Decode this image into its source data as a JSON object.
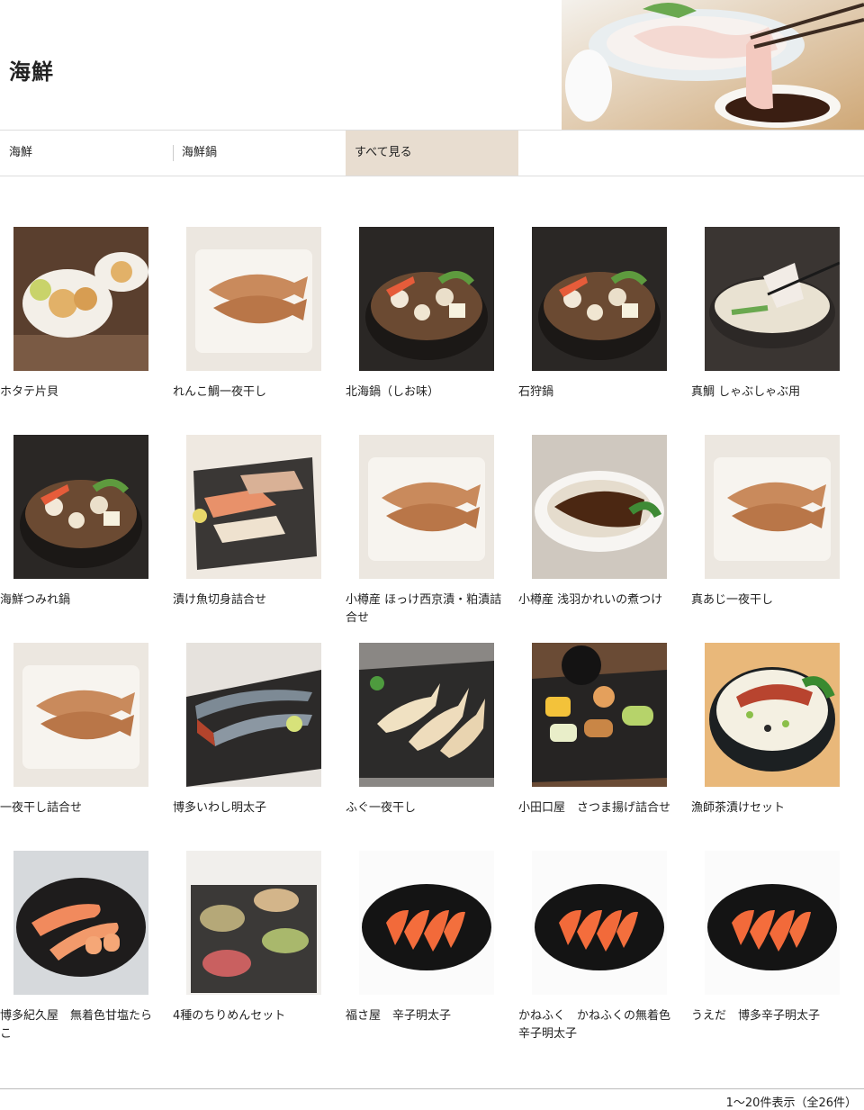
{
  "page": {
    "title": "海鮮"
  },
  "tabs": [
    {
      "label": "海鮮"
    },
    {
      "label": "海鮮鍋"
    },
    {
      "label": "すべて見る"
    }
  ],
  "products": [
    {
      "name": "ホタテ片貝",
      "kind": "scallop"
    },
    {
      "name": "れんこ鯛一夜干し",
      "kind": "fishplate"
    },
    {
      "name": "北海鍋（しお味）",
      "kind": "pot"
    },
    {
      "name": "石狩鍋",
      "kind": "pot"
    },
    {
      "name": "真鯛 しゃぶしゃぶ用",
      "kind": "shabu"
    },
    {
      "name": "海鮮つみれ鍋",
      "kind": "pot"
    },
    {
      "name": "漬け魚切身詰合せ",
      "kind": "fillets"
    },
    {
      "name": "小樽産 ほっけ西京漬・粕漬詰合せ",
      "kind": "fishplate"
    },
    {
      "name": "小樽産 浅羽かれいの煮つけ",
      "kind": "bowlfish"
    },
    {
      "name": "真あじ一夜干し",
      "kind": "fishplate"
    },
    {
      "name": "一夜干し詰合せ",
      "kind": "fishplate"
    },
    {
      "name": "博多いわし明太子",
      "kind": "sardine"
    },
    {
      "name": "ふぐ一夜干し",
      "kind": "fugu"
    },
    {
      "name": "小田口屋　さつま揚げ詰合せ",
      "kind": "satsuma"
    },
    {
      "name": "漁師茶漬けセット",
      "kind": "chazuke"
    },
    {
      "name": "博多紀久屋　無着色甘塩たらこ",
      "kind": "tarako"
    },
    {
      "name": "4種のちりめんセット",
      "kind": "chirimen"
    },
    {
      "name": "福さ屋　辛子明太子",
      "kind": "mentaiko"
    },
    {
      "name": "かねふく　かねふくの無着色辛子明太子",
      "kind": "mentaiko"
    },
    {
      "name": "うえだ　博多辛子明太子",
      "kind": "mentaiko"
    }
  ],
  "pagination": {
    "count_text": "1～20件表示（全26件）"
  }
}
